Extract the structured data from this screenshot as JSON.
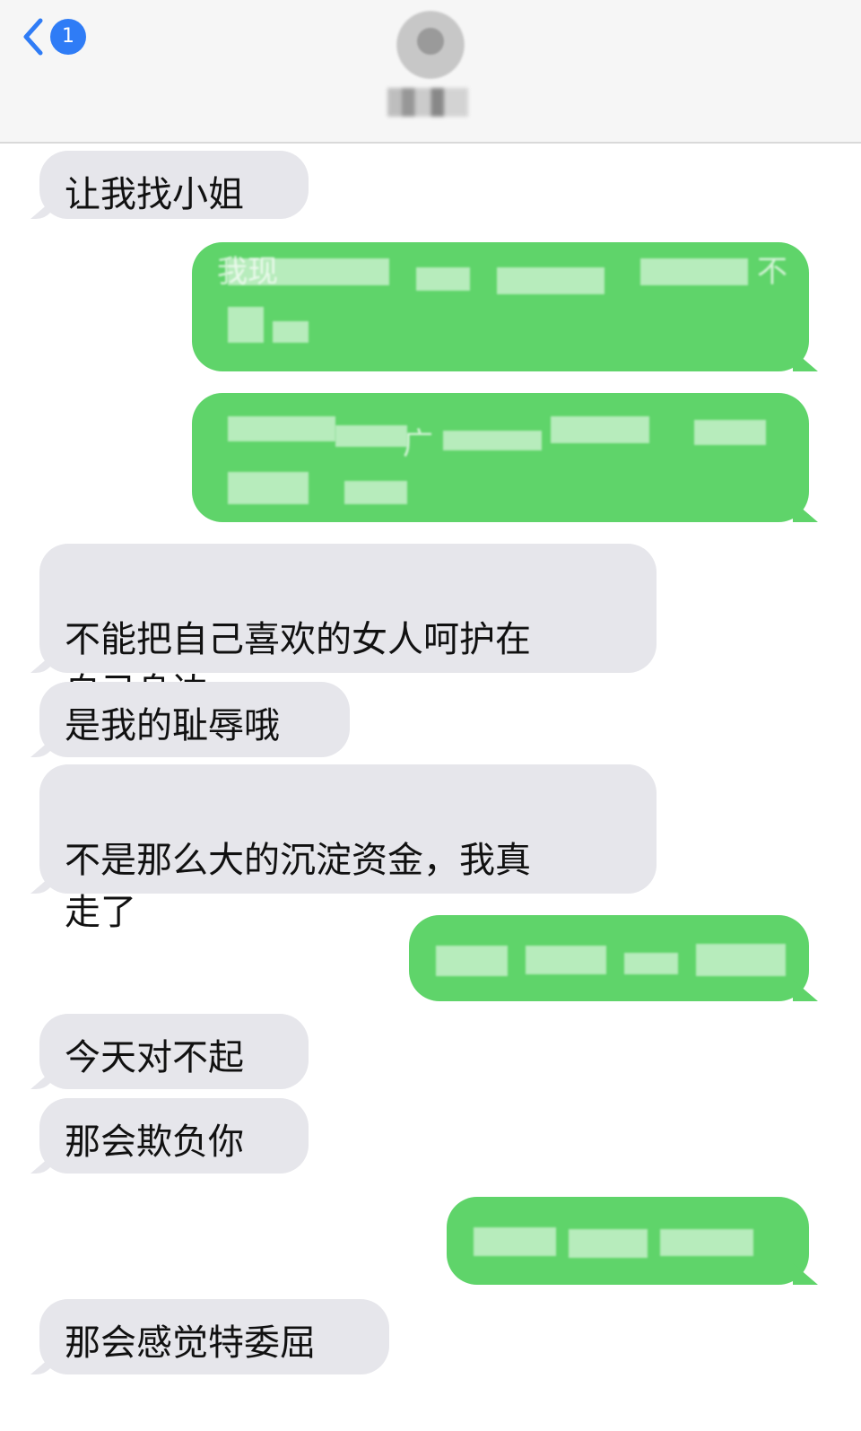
{
  "header": {
    "back_badge": "1",
    "back_icon": "chevron-left-icon"
  },
  "messages": [
    {
      "side": "incoming",
      "text": "让我找小姐"
    },
    {
      "side": "outgoing",
      "text": "我现",
      "suffix": "不"
    },
    {
      "side": "outgoing",
      "text": "广"
    },
    {
      "side": "incoming",
      "text": "不能把自己喜欢的女人呵护在\n自己身边"
    },
    {
      "side": "incoming",
      "text": "是我的耻辱哦"
    },
    {
      "side": "incoming",
      "text": "不是那么大的沉淀资金，我真\n走了"
    },
    {
      "side": "outgoing",
      "text": ""
    },
    {
      "side": "incoming",
      "text": "今天对不起"
    },
    {
      "side": "incoming",
      "text": "那会欺负你"
    },
    {
      "side": "outgoing",
      "text": ""
    },
    {
      "side": "incoming",
      "text": "那会感觉特委屈"
    }
  ],
  "colors": {
    "incoming_bubble": "#e6e6eb",
    "outgoing_bubble": "#5fd46a",
    "badge": "#2f7cf6"
  }
}
